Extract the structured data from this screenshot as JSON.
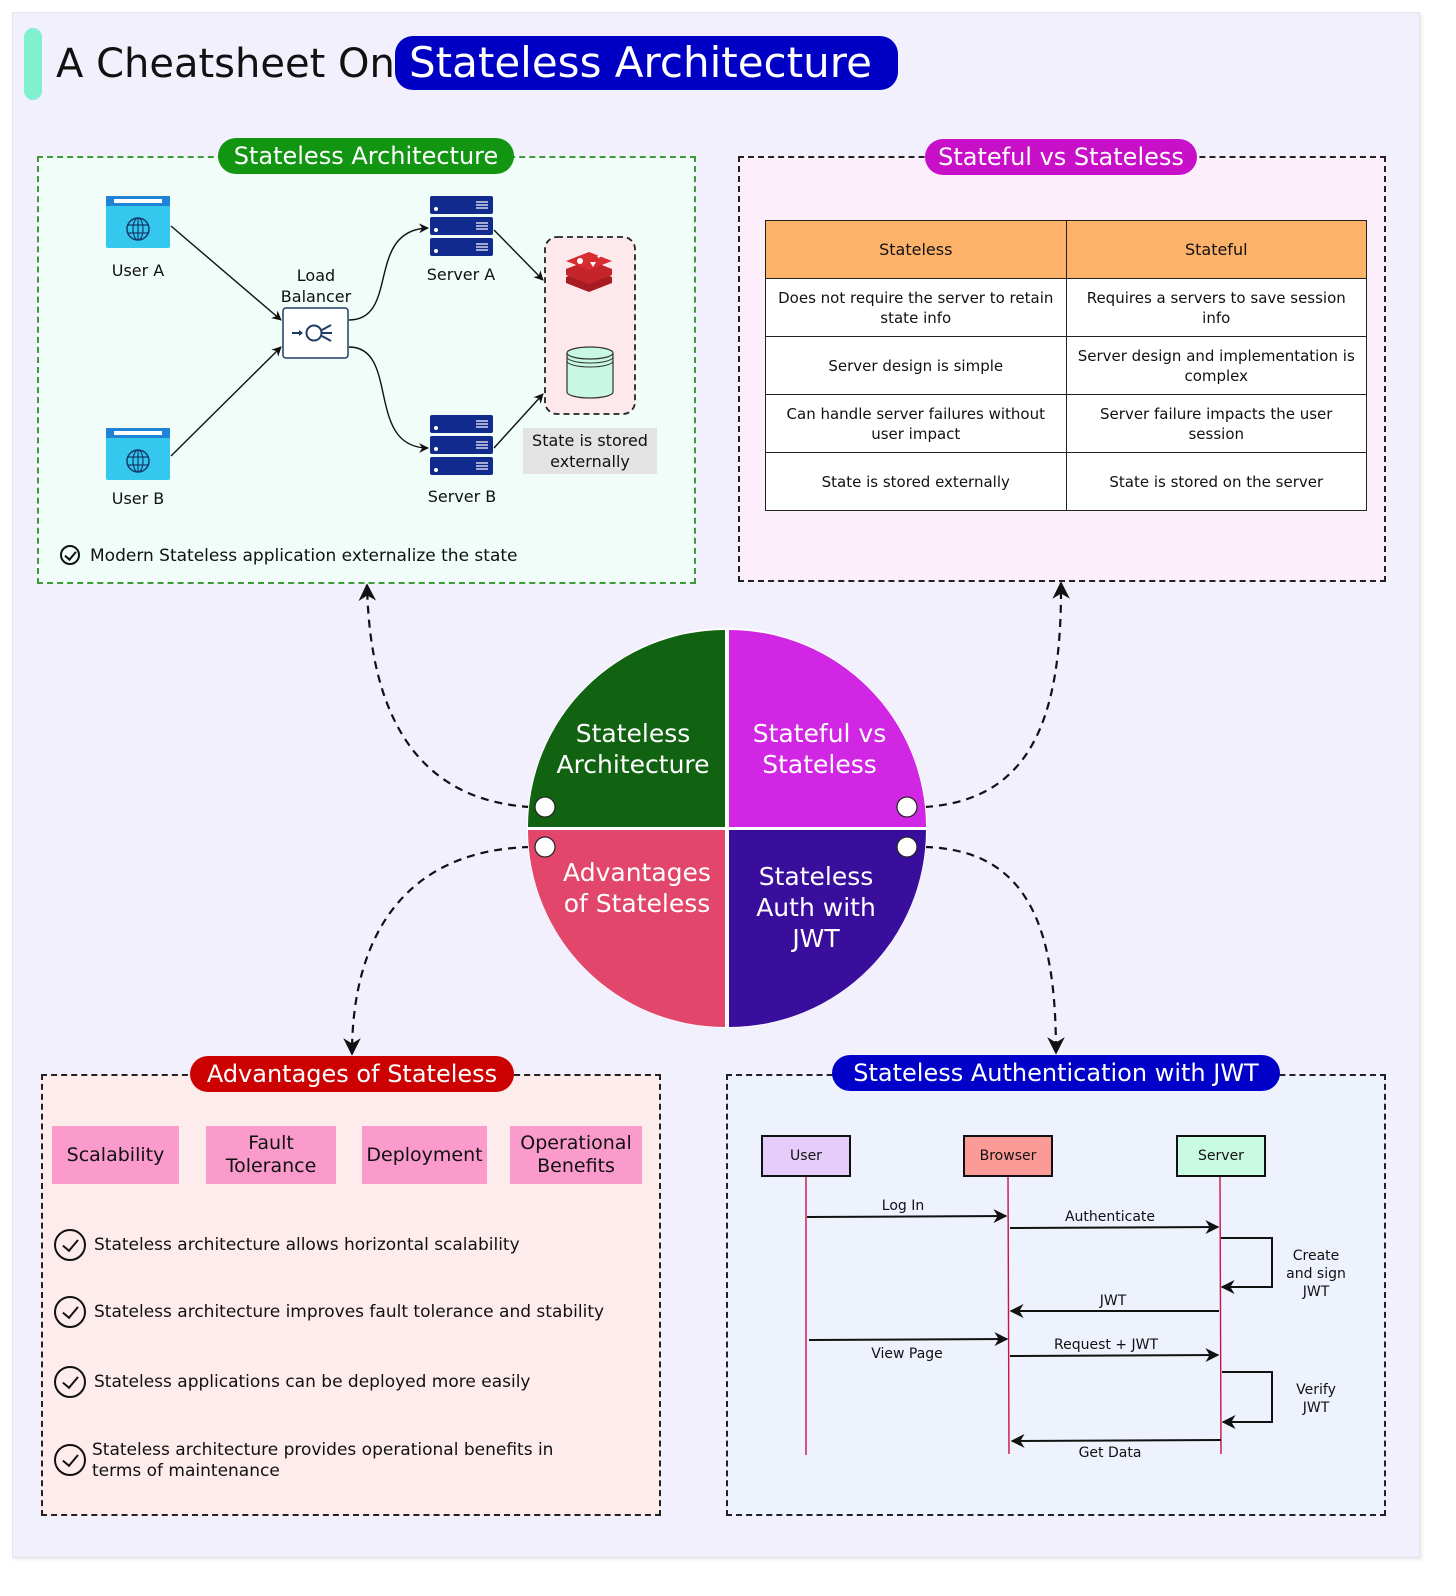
{
  "header": {
    "title_prefix": "A Cheatsheet On",
    "title_highlight": "Stateless Architecture"
  },
  "colors": {
    "accent_bar": "#7ff0d0",
    "title_pill": "#0000c4",
    "arch": "#129612",
    "vs": "#c810c8",
    "adv": "#cc0000",
    "jwt": "#0000c8",
    "table_header": "#fdb26a",
    "adv_tag": "#fb9bcb",
    "lifeline": "#cc1144"
  },
  "stateless_architecture": {
    "title": "Stateless Architecture",
    "nodes": {
      "user_a": "User A",
      "user_b": "User B",
      "load_balancer": "Load Balancer",
      "server_a": "Server A",
      "server_b": "Server B",
      "state_store_note": "State is stored externally"
    },
    "note": "Modern Stateless application externalize the state",
    "icons": [
      "browser-globe-icon",
      "load-balancer-icon",
      "server-rack-icon",
      "redis-icon",
      "database-icon",
      "check-circle-icon"
    ]
  },
  "stateful_vs_stateless": {
    "title": "Stateful vs Stateless",
    "columns": [
      "Stateless",
      "Stateful"
    ],
    "rows": [
      [
        "Does not require the server to retain state info",
        "Requires a servers to save session info"
      ],
      [
        "Server design is simple",
        "Server design and implementation is complex"
      ],
      [
        "Can handle server failures without user impact",
        "Server failure impacts the user session"
      ],
      [
        "State is stored externally",
        "State is stored on the server"
      ]
    ]
  },
  "hub": {
    "quadrants": [
      {
        "label": "Stateless Architecture",
        "color": "#116311"
      },
      {
        "label": "Stateful vs Stateless",
        "color": "#d126e3"
      },
      {
        "label": "Advantages of Stateless",
        "color": "#e2466b"
      },
      {
        "label": "Stateless Auth with JWT",
        "color": "#3a0e9c"
      }
    ]
  },
  "advantages": {
    "title": "Advantages of Stateless",
    "tags": [
      "Scalability",
      "Fault Tolerance",
      "Deployment",
      "Operational Benefits"
    ],
    "items": [
      "Stateless architecture allows horizontal scalability",
      "Stateless architecture improves fault tolerance and stability",
      "Stateless applications can be deployed more easily",
      "Stateless architecture provides operational benefits in terms of maintenance"
    ]
  },
  "jwt_auth": {
    "title": "Stateless Authentication with JWT",
    "actors": [
      {
        "label": "User",
        "color": "#e6ccfb"
      },
      {
        "label": "Browser",
        "color": "#fb9a96"
      },
      {
        "label": "Server",
        "color": "#c8fbe2"
      }
    ],
    "messages": [
      {
        "label": "Log In",
        "from": "User",
        "to": "Browser"
      },
      {
        "label": "Authenticate",
        "from": "Browser",
        "to": "Server"
      },
      {
        "label": "Create and sign JWT",
        "from": "Server",
        "to": "Server"
      },
      {
        "label": "JWT",
        "from": "Server",
        "to": "Browser"
      },
      {
        "label": "View Page",
        "from": "User",
        "to": "Browser"
      },
      {
        "label": "Request + JWT",
        "from": "Browser",
        "to": "Server"
      },
      {
        "label": "Verify JWT",
        "from": "Server",
        "to": "Server"
      },
      {
        "label": "Get Data",
        "from": "Server",
        "to": "Browser"
      }
    ]
  }
}
